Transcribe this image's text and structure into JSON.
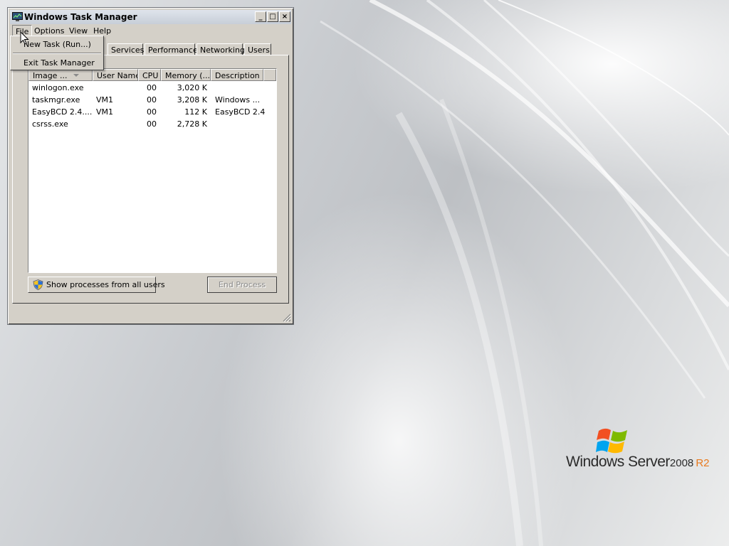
{
  "window": {
    "title": "Windows Task Manager",
    "controls": {
      "minimize": "_",
      "maximize": "□",
      "close": "×"
    }
  },
  "menu": {
    "items": [
      "File",
      "Options",
      "View",
      "Help"
    ]
  },
  "file_menu": {
    "items": [
      "New Task (Run...)",
      "Exit Task Manager"
    ]
  },
  "tabs": {
    "items": [
      "Services",
      "Performance",
      "Networking",
      "Users"
    ]
  },
  "table": {
    "columns": [
      "Image ...",
      "User Name",
      "CPU",
      "Memory (...",
      "Description"
    ],
    "rows": [
      {
        "image": "winlogon.exe",
        "user": "",
        "cpu": "00",
        "memory": "3,020 K",
        "description": ""
      },
      {
        "image": "taskmgr.exe",
        "user": "VM1",
        "cpu": "00",
        "memory": "3,208 K",
        "description": "Windows ..."
      },
      {
        "image": "EasyBCD 2.4....",
        "user": "VM1",
        "cpu": "00",
        "memory": "112 K",
        "description": "EasyBCD 2.4"
      },
      {
        "image": "csrss.exe",
        "user": "",
        "cpu": "00",
        "memory": "2,728 K",
        "description": ""
      }
    ]
  },
  "buttons": {
    "show_all": "Show processes from all users",
    "end_process": "End Process"
  },
  "branding": {
    "product": "Windows Server",
    "version": "2008",
    "release": "R2"
  },
  "colors": {
    "flag_red": "#f25022",
    "flag_green": "#7fba00",
    "flag_blue": "#00a4ef",
    "flag_yellow": "#ffb900",
    "r2_accent": "#e87a1e"
  }
}
